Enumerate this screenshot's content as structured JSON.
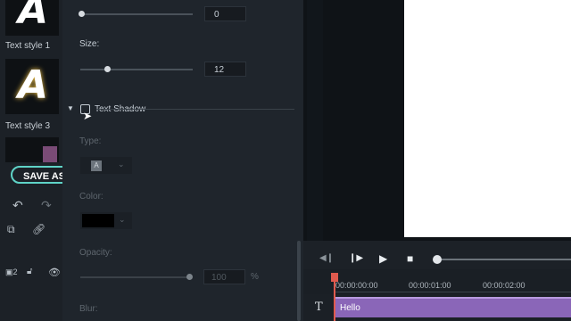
{
  "style_panel": {
    "items": [
      {
        "label": "Text style 1",
        "glyph": "A"
      },
      {
        "label": "Text style 3",
        "glyph": "A"
      }
    ],
    "save_as_label": "SAVE AS"
  },
  "settings": {
    "top_slider_value": "0",
    "size": {
      "label": "Size:",
      "value": "12"
    },
    "text_shadow": {
      "label": "Text Shadow",
      "checked": false
    },
    "type": {
      "label": "Type:",
      "value": "A"
    },
    "color": {
      "label": "Color:",
      "swatch": "#000000"
    },
    "opacity": {
      "label": "Opacity:",
      "value": "100",
      "unit": "%",
      "fraction": 1.0
    },
    "blur": {
      "label": "Blur:"
    }
  },
  "player": {
    "timecodes": [
      "00:00:00:00",
      "00:00:01:00",
      "00:00:02:00"
    ]
  },
  "timeline": {
    "clip_label": "Hello",
    "track_icon": "T"
  },
  "colors": {
    "accent": "#5fd3c7",
    "clip": "#8a66b8",
    "playhead": "#e05a4e"
  }
}
